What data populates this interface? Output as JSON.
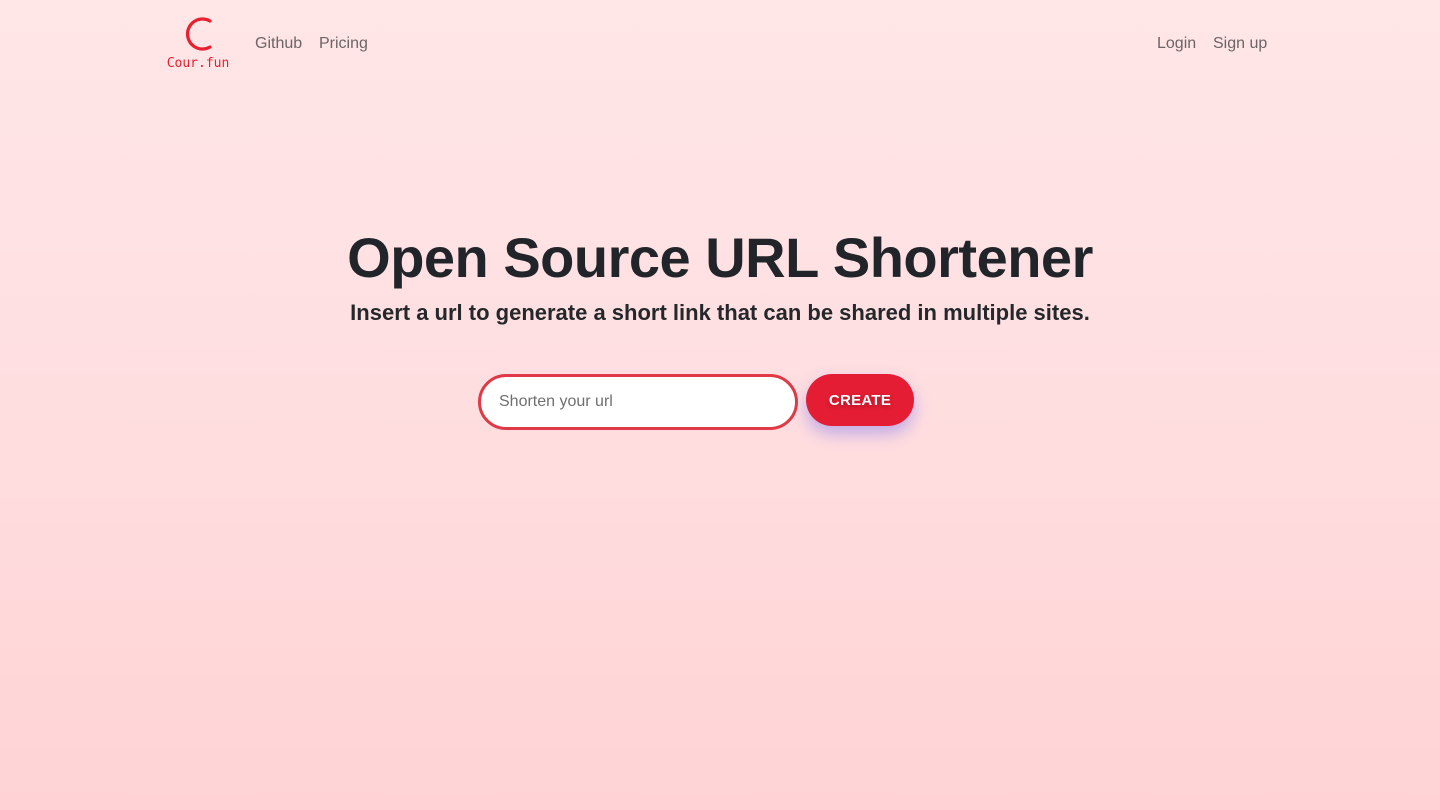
{
  "brand": {
    "name": "Cour.fun",
    "accent_color": "#e8202f"
  },
  "nav": {
    "left": [
      {
        "label": "Github"
      },
      {
        "label": "Pricing"
      }
    ],
    "right": [
      {
        "label": "Login"
      },
      {
        "label": "Sign up"
      }
    ]
  },
  "hero": {
    "title": "Open Source URL Shortener",
    "subtitle": "Insert a url to generate a short link that can be shared in multiple sites."
  },
  "form": {
    "url_placeholder": "Shorten your url",
    "url_value": "",
    "button_label": "CREATE",
    "button_color": "#e51d34"
  }
}
